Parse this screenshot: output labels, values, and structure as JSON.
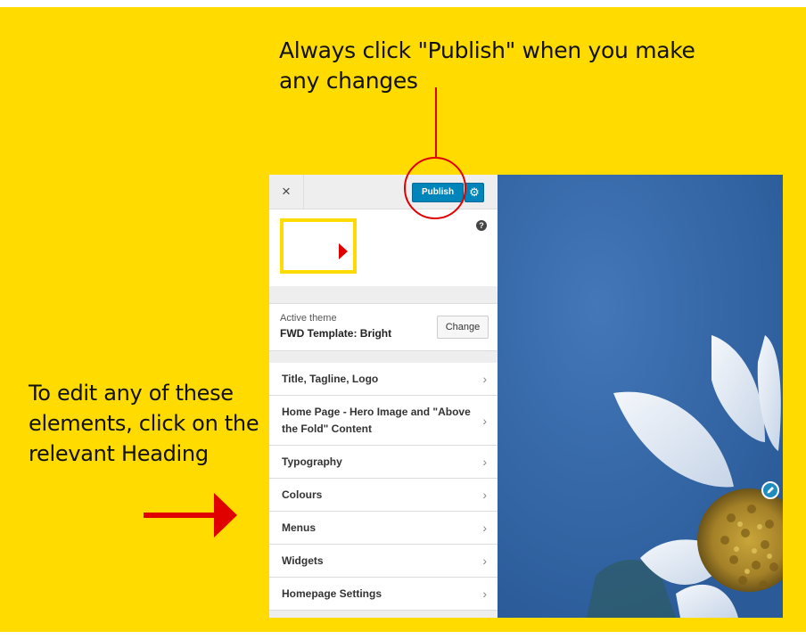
{
  "annotations": {
    "top_text": "Always click \"Publish\" when you make any changes",
    "left_text": "To edit any of these elements, click on the relevant Heading"
  },
  "customizer": {
    "close_glyph": "×",
    "publish_label": "Publish",
    "gear_glyph": "⚙",
    "help_glyph": "?",
    "active_theme_label": "Active theme",
    "active_theme_name": "FWD Template: Bright",
    "change_label": "Change",
    "menu_items": [
      {
        "label": "Title, Tagline, Logo"
      },
      {
        "label": "Home Page - Hero Image and \"Above the Fold\" Content"
      },
      {
        "label": "Typography"
      },
      {
        "label": "Colours"
      },
      {
        "label": "Menus"
      },
      {
        "label": "Widgets"
      },
      {
        "label": "Homepage Settings"
      }
    ],
    "chevron_glyph": "›"
  },
  "preview": {
    "edit_icon": "pencil-icon"
  },
  "colors": {
    "background": "#ffdb00",
    "accent_red": "#e10000",
    "publish_blue": "#0085ba",
    "preview_blue": "#3767a8"
  }
}
